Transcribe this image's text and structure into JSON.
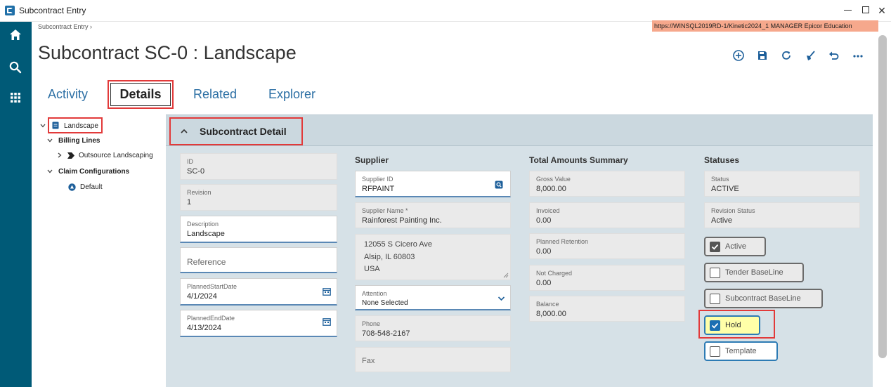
{
  "window": {
    "title": "Subcontract Entry",
    "min_label": "–",
    "close_label": "✕"
  },
  "breadcrumb": "Subcontract Entry  ›",
  "environment": "https://WINSQL2019RD-1/Kinetic2024_1   MANAGER   Epicor Education",
  "page_title": "Subcontract SC-0 : Landscape",
  "tabs": [
    {
      "label": "Activity"
    },
    {
      "label": "Details"
    },
    {
      "label": "Related"
    },
    {
      "label": "Explorer"
    }
  ],
  "tree": {
    "root": "Landscape",
    "billing_lines": "Billing Lines",
    "billing_child": "Outsource Landscaping",
    "claim_configs": "Claim Configurations",
    "claim_child": "Default"
  },
  "panel": {
    "title": "Subcontract Detail"
  },
  "columns": {
    "supplier": "Supplier",
    "totals": "Total Amounts Summary",
    "statuses": "Statuses"
  },
  "fields": {
    "id": {
      "label": "ID",
      "value": "SC-0"
    },
    "revision": {
      "label": "Revision",
      "value": "1"
    },
    "description": {
      "label": "Description",
      "value": "Landscape"
    },
    "reference": {
      "label": "Reference"
    },
    "planned_start": {
      "label": "PlannedStartDate",
      "value": "4/1/2024"
    },
    "planned_end": {
      "label": "PlannedEndDate",
      "value": "4/13/2024"
    },
    "supplier_id": {
      "label": "Supplier ID",
      "value": "RFPAINT"
    },
    "supplier_name": {
      "label": "Supplier Name *",
      "value": "Rainforest Painting Inc."
    },
    "address": [
      "12055 S Cicero Ave",
      "Alsip, IL  60803",
      "USA"
    ],
    "attention": {
      "label": "Attention",
      "value": "None Selected"
    },
    "phone": {
      "label": "Phone",
      "value": "708-548-2167"
    },
    "fax": {
      "label": "Fax"
    },
    "gross_value": {
      "label": "Gross Value",
      "value": "8,000.00"
    },
    "invoiced": {
      "label": "Invoiced",
      "value": "0.00"
    },
    "planned_retention": {
      "label": "Planned Retention",
      "value": "0.00"
    },
    "not_charged": {
      "label": "Not Charged",
      "value": "0.00"
    },
    "balance": {
      "label": "Balance",
      "value": "8,000.00"
    },
    "status": {
      "label": "Status",
      "value": "ACTIVE"
    },
    "revision_status": {
      "label": "Revision Status",
      "value": "Active"
    }
  },
  "checkboxes": {
    "active": {
      "label": "Active",
      "checked": true
    },
    "tender_baseline": {
      "label": "Tender BaseLine",
      "checked": false
    },
    "subcontract_baseline": {
      "label": "Subcontract BaseLine",
      "checked": false
    },
    "hold": {
      "label": "Hold",
      "checked": true
    },
    "template": {
      "label": "Template",
      "checked": false
    }
  },
  "colors": {
    "rail": "#005a77",
    "accent": "#2c6fa4",
    "highlight_border": "#e23a3a",
    "env_banner": "#f6a88c",
    "hold_bg": "#ffffa8"
  }
}
